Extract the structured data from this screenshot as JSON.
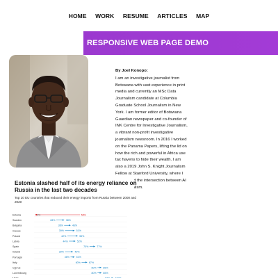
{
  "nav": {
    "items": [
      {
        "label": "HOME"
      },
      {
        "label": "WORK"
      },
      {
        "label": "RESUME"
      },
      {
        "label": "ARTICLES"
      },
      {
        "label": "MAP"
      }
    ]
  },
  "banner": {
    "title": "RESPONSIVE WEB PAGE DEMO",
    "color": "#a13ad4"
  },
  "bio": {
    "byline": "By Joel Konopo:",
    "text": "I am an investigative journalist from Botswana with vast experience in print media and currently an MSc Data Journalism candidate at Columbia Graduate School Journalism in New York. I am former editor of Botswana Guardian newspaper and co-founder of INK Centre for Investigative Journalism, a vibrant non-profit investigative journalism newsroom. In 2016 I worked on the Panama Papers, lifting the lid on how the rich and powerful in Africa use tax havens to hide their wealth. I am also a 2019 John S. Knight Journalism Fellow at Stanford University, where I researched the intersection between AI and journalism."
  },
  "chart": {
    "title": "Estonia slashed half of its energy reliance on Russia in the last two decades",
    "subtitle": "Top 10 EU countries that reduced their energy imports from Russia between 2000 and 2020",
    "colors": {
      "decrease": "#e0262a",
      "increase": "#1a87c8"
    }
  },
  "chart_data": {
    "type": "dumbbell",
    "title": "Estonia slashed half of its energy reliance on Russia in the last two decades",
    "subtitle": "Top 10 EU countries that reduced their energy imports from Russia between 2000 and 2020",
    "rows": [
      {
        "country": "Estonia",
        "start": 0,
        "end": 0,
        "start_label": "0%",
        "end_label": "58%"
      },
      {
        "country": "Sweden",
        "start": 28,
        "end": 38,
        "start_label": "28%",
        "end_label": "38%"
      },
      {
        "country": "Bulgaria",
        "start": 38,
        "end": 46,
        "start_label": "38%",
        "end_label": "46%"
      },
      {
        "country": "Greece",
        "start": 39,
        "end": 51,
        "start_label": "39%",
        "end_label": "51%"
      },
      {
        "country": "Poland",
        "start": 42,
        "end": 55,
        "start_label": "42%",
        "end_label": "55%"
      },
      {
        "country": "Latvia",
        "start": 44,
        "end": 52,
        "start_label": "44%",
        "end_label": "52%"
      },
      {
        "country": "Spain",
        "start": 70,
        "end": 77,
        "start_label": "70%",
        "end_label": "77%"
      },
      {
        "country": "Ireland",
        "start": 39,
        "end": 49,
        "start_label": "39%",
        "end_label": "49%"
      },
      {
        "country": "Portugal",
        "start": 46,
        "end": 51,
        "start_label": "46%",
        "end_label": "51%"
      },
      {
        "country": "Italy",
        "start": 60,
        "end": 67,
        "start_label": "60%",
        "end_label": "67%"
      },
      {
        "country": "Cyprus",
        "start": 80,
        "end": 85,
        "start_label": "80%",
        "end_label": "85%"
      },
      {
        "country": "Luxembourg",
        "start": 80,
        "end": 85,
        "start_label": "80%",
        "end_label": "85%"
      },
      {
        "country": "Malta",
        "start": 97,
        "end": 100,
        "start_label": "97%",
        "end_label": "100%"
      }
    ]
  }
}
